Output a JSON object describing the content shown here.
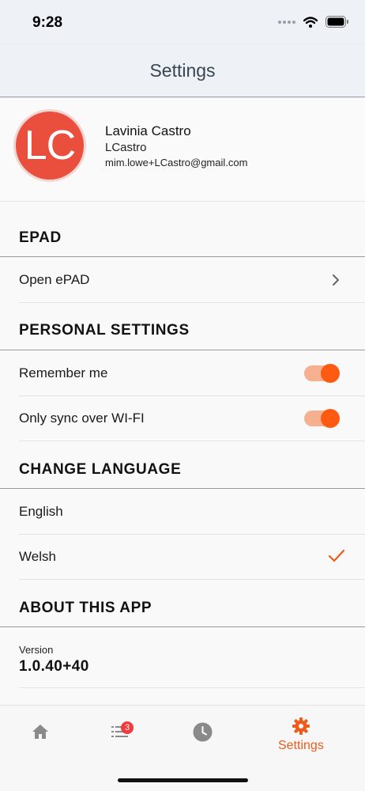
{
  "status_bar": {
    "time": "9:28",
    "wifi_icon": "wifi-icon",
    "battery_icon": "battery-icon"
  },
  "nav": {
    "title": "Settings"
  },
  "profile": {
    "initials": "LC",
    "name": "Lavinia Castro",
    "username": "LCastro",
    "email": "mim.lowe+LCastro@gmail.com",
    "avatar_color": "#e94f3c"
  },
  "sections": {
    "epad": {
      "header": "EPAD",
      "open_label": "Open ePAD"
    },
    "personal": {
      "header": "PERSONAL SETTINGS",
      "remember_me": {
        "label": "Remember me",
        "enabled": true
      },
      "wifi_sync": {
        "label": "Only sync over WI-FI",
        "enabled": true
      }
    },
    "language": {
      "header": "CHANGE LANGUAGE",
      "options": [
        "English",
        "Welsh"
      ],
      "selected": "Welsh"
    },
    "about": {
      "header": "ABOUT THIS APP",
      "version_label": "Version",
      "version": "1.0.40+40"
    }
  },
  "tab_bar": {
    "tabs": [
      {
        "icon": "home-icon"
      },
      {
        "icon": "list-icon",
        "badge": "3"
      },
      {
        "icon": "clock-icon"
      },
      {
        "icon": "gear-icon",
        "label": "Settings",
        "active": true
      }
    ]
  },
  "colors": {
    "accent": "#ee5b1a",
    "toggle_track": "#f6b08f",
    "toggle_knob": "#ff5a12"
  }
}
